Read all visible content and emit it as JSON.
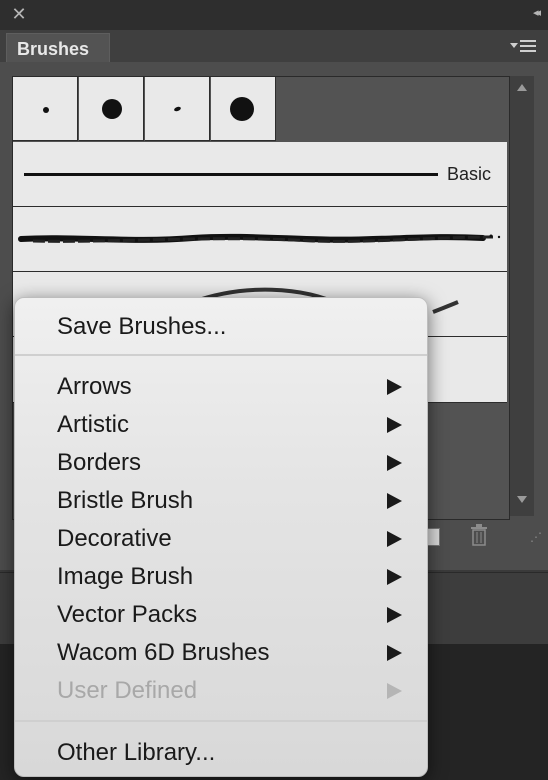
{
  "window": {
    "close_glyph": "✕",
    "collapse_glyph": "◂◂"
  },
  "panel": {
    "tab_title": "Brushes"
  },
  "brushes": {
    "basic_label": "Basic"
  },
  "context_menu": {
    "save_label": "Save Brushes...",
    "items": [
      {
        "label": "Arrows",
        "enabled": true
      },
      {
        "label": "Artistic",
        "enabled": true
      },
      {
        "label": "Borders",
        "enabled": true
      },
      {
        "label": "Bristle Brush",
        "enabled": true
      },
      {
        "label": "Decorative",
        "enabled": true
      },
      {
        "label": "Image Brush",
        "enabled": true
      },
      {
        "label": "Vector Packs",
        "enabled": true
      },
      {
        "label": "Wacom 6D Brushes",
        "enabled": true
      },
      {
        "label": "User Defined",
        "enabled": false
      }
    ],
    "other_label": "Other Library..."
  },
  "icons": {
    "close": "close-icon",
    "collapse": "collapse-panel-icon",
    "panel_menu": "panel-menu-icon",
    "delete": "trash-icon",
    "submenu": "submenu-arrow-icon"
  },
  "colors": {
    "panel_bg": "#4d4d4d",
    "menu_bg": "#e6e6e6",
    "disabled_text": "#a8a8a8"
  }
}
